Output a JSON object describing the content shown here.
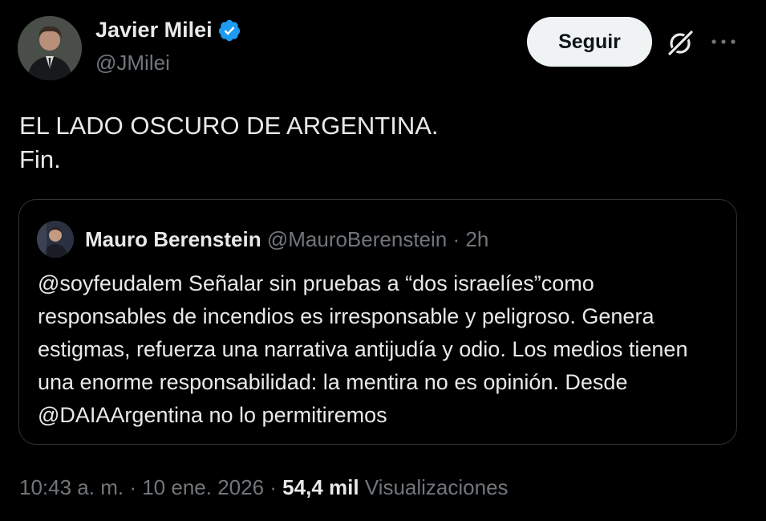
{
  "author": {
    "display_name": "Javier Milei",
    "handle": "@JMilei",
    "verified": true
  },
  "actions": {
    "follow_label": "Seguir",
    "grok_icon": "grok-icon",
    "more_icon": "more-icon"
  },
  "tweet": {
    "line1": "EL LADO OSCURO DE ARGENTINA.",
    "line2": "Fin."
  },
  "quote": {
    "display_name": "Mauro Berenstein",
    "handle": "@MauroBerenstein",
    "separator": "·",
    "time": "2h",
    "text": "@soyfeudalem Señalar sin pruebas a “dos israelíes”como responsables de incendios es irresponsable y peligroso. Genera estigmas, refuerza una narrativa antijudía y odio. Los medios tienen una enorme responsabilidad: la mentira no es opinión. Desde @DAIAArgentina no lo permitiremos"
  },
  "footer": {
    "time": "10:43 a. m.",
    "separator1": "·",
    "date": "10 ene. 2026",
    "separator2": "·",
    "views_count": "54,4 mil",
    "views_label": "Visualizaciones"
  },
  "colors": {
    "background": "#000000",
    "primary_text": "#e7e9ea",
    "secondary_text": "#71767b",
    "border": "#2f3336",
    "verified_badge": "#1d9bf0",
    "follow_button_bg": "#eff3f4"
  }
}
